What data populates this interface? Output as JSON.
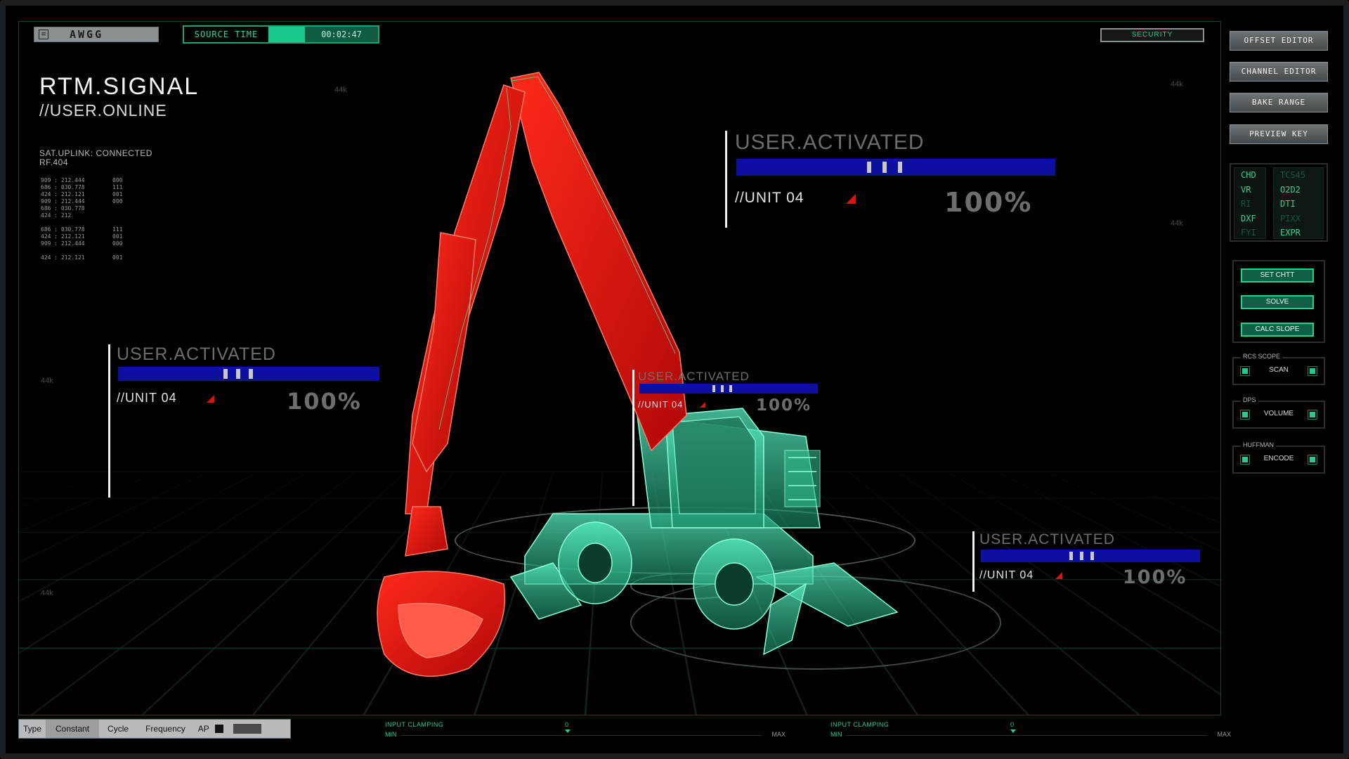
{
  "topbar": {
    "app_name": "AWGG",
    "source_time_label": "SOURCE TIME",
    "source_time_value": "00:02:47",
    "security_label": "SECURITY"
  },
  "header": {
    "title": "RTM.SIGNAL",
    "subtitle": "//USER.ONLINE",
    "uplink_line1": "SAT.UPLINK: CONNECTED",
    "uplink_line2": "RF.404"
  },
  "k_labels": [
    "44k",
    "44k",
    "44k",
    "44k",
    "44k"
  ],
  "data_table": [
    {
      "a": "909 : 212.444",
      "b": "000"
    },
    {
      "a": "686 : 030.778",
      "b": "111"
    },
    {
      "a": "424 : 212.121",
      "b": "001"
    },
    {
      "a": "909 : 212.444",
      "b": "000"
    },
    {
      "a": "686 : 030.778",
      "b": ""
    },
    {
      "a": "424 : 212",
      "b": ""
    },
    {
      "a": "686 : 030.778",
      "b": "111"
    },
    {
      "a": "424 : 212.121",
      "b": "001"
    },
    {
      "a": "909 : 212.444",
      "b": "000"
    },
    {
      "a": "424 : 212.121",
      "b": "001"
    }
  ],
  "panels": [
    {
      "title": "USER.ACTIVATED",
      "unit": "//UNIT 04",
      "percent": "100%"
    },
    {
      "title": "USER.ACTIVATED",
      "unit": "//UNIT 04",
      "percent": "100%"
    },
    {
      "title": "USER.ACTIVATED",
      "unit": "//UNIT 04",
      "percent": "100%"
    },
    {
      "title": "USER.ACTIVATED",
      "unit": "//UNIT 04",
      "percent": "100%"
    }
  ],
  "right_panel": {
    "buttons": [
      "OFFSET EDITOR",
      "CHANNEL EDITOR",
      "BAKE RANGE",
      "PREVIEW KEY"
    ],
    "channels_left": [
      "CHD",
      "VR",
      "RI",
      "DXF",
      "FYI"
    ],
    "channels_right": [
      "TCS45",
      "O2D2",
      "DTI",
      "PIXX",
      "EXPR"
    ],
    "actions": [
      "SET CHTT",
      "SOLVE",
      "CALC SLOPE"
    ],
    "options": [
      {
        "group": "RCS SCOPE",
        "label": "SCAN"
      },
      {
        "group": "DPS",
        "label": "VOLUME"
      },
      {
        "group": "HUFFMAN",
        "label": "ENCODE"
      }
    ]
  },
  "bottom": {
    "type_label": "Type",
    "constant_label": "Constant",
    "cycle_label": "Cycle",
    "frequency_label": "Frequency",
    "ap_label": "AP",
    "clamp_label": "INPUT CLAMPING",
    "clamp_min": "MIN",
    "clamp_max": "MAX",
    "clamp_zero": "0"
  },
  "colors": {
    "accent_green": "#23d28f",
    "bar_blue": "#0c0fa0",
    "arm_red": "#e01010",
    "body_green": "#3fe0b0"
  },
  "icons": [
    "menu-icon",
    "triangle-marker-icon",
    "chevron-down-icon"
  ]
}
